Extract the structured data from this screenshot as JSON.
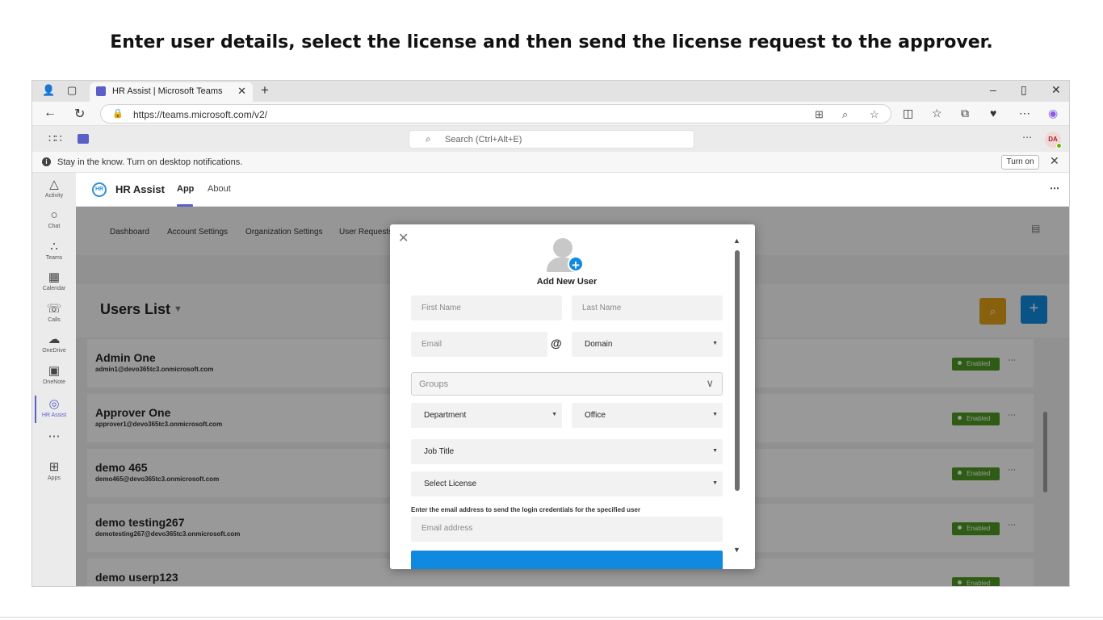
{
  "slide": {
    "title": "Enter user details, select the license and then send the license request to the approver."
  },
  "browser": {
    "tab_title": "HR Assist | Microsoft Teams",
    "url": "https://teams.microsoft.com/v2/"
  },
  "teams": {
    "search_placeholder": "Search (Ctrl+Alt+E)",
    "avatar_initials": "DA",
    "notification": {
      "text": "Stay in the know. Turn on desktop notifications.",
      "button": "Turn on"
    },
    "rail": [
      {
        "label": "Activity",
        "icon": "bell-icon"
      },
      {
        "label": "Chat",
        "icon": "chat-icon"
      },
      {
        "label": "Teams",
        "icon": "teams-icon"
      },
      {
        "label": "Calendar",
        "icon": "calendar-icon"
      },
      {
        "label": "Calls",
        "icon": "phone-icon"
      },
      {
        "label": "OneDrive",
        "icon": "cloud-icon"
      },
      {
        "label": "OneNote",
        "icon": "onenote-icon"
      },
      {
        "label": "HR Assist",
        "icon": "hr-assist-icon"
      },
      {
        "label": "Apps",
        "icon": "apps-icon"
      }
    ]
  },
  "app": {
    "name": "HR Assist",
    "tabs": [
      "App",
      "About"
    ],
    "menu": [
      "Dashboard",
      "Account Settings",
      "Organization Settings",
      "User Requests"
    ],
    "users_title": "Users List",
    "users": [
      {
        "name": "Admin One",
        "email": "admin1@devo365tc3.onmicrosoft.com",
        "status": "Enabled"
      },
      {
        "name": "Approver One",
        "email": "approver1@devo365tc3.onmicrosoft.com",
        "status": "Enabled"
      },
      {
        "name": "demo 465",
        "email": "demo465@devo365tc3.onmicrosoft.com",
        "status": "Enabled"
      },
      {
        "name": "demo testing267",
        "email": "demotesting267@devo365tc3.onmicrosoft.com",
        "status": "Enabled"
      },
      {
        "name": "demo userp123",
        "email": "",
        "status": "Enabled"
      }
    ]
  },
  "modal": {
    "title": "Add New User",
    "first_name_placeholder": "First Name",
    "last_name_placeholder": "Last Name",
    "email_placeholder": "Email",
    "at_sign": "@",
    "domain": "Domain",
    "groups_placeholder": "Groups",
    "department": "Department",
    "office": "Office",
    "job_title": "Job Title",
    "license": "Select License",
    "instruction": "Enter the email address to send the login credentials for the specified user",
    "email_address_placeholder": "Email address"
  },
  "colors": {
    "teams_purple": "#5b5fc7",
    "primary_blue": "#0f8ae0",
    "search_orange": "#e3a21a",
    "enabled_green": "#4f9a23"
  }
}
